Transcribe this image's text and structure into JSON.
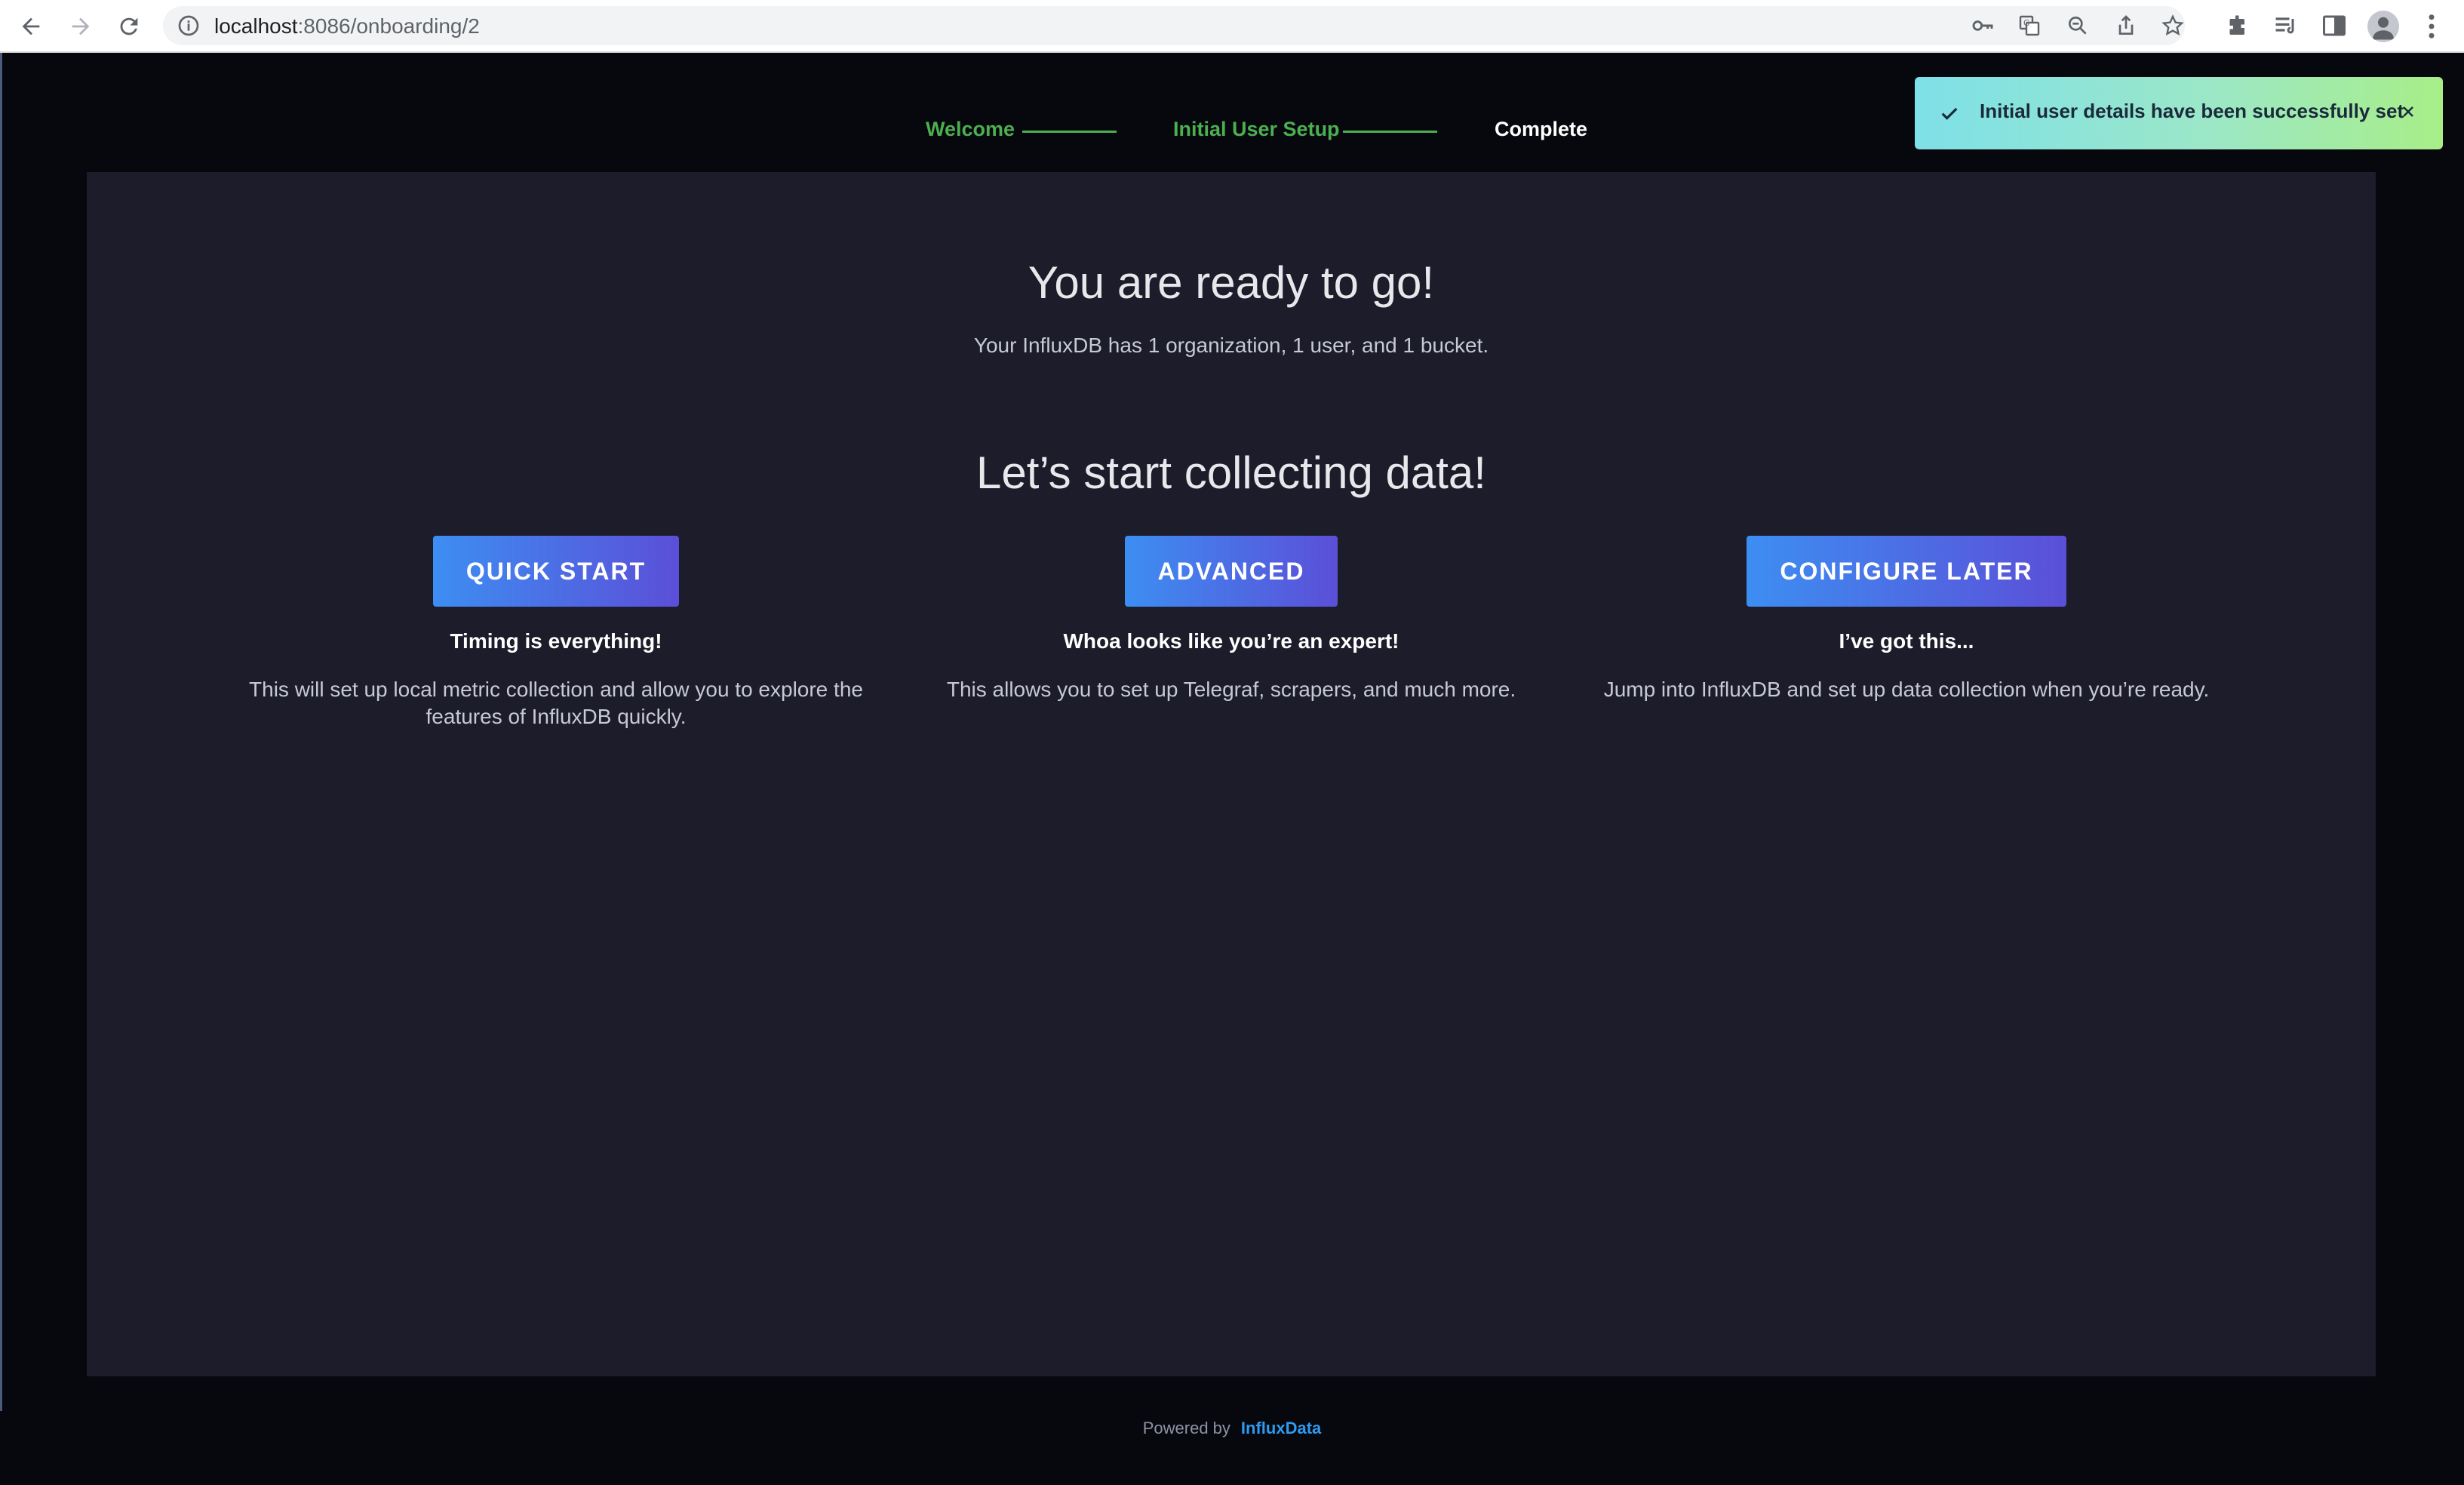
{
  "browser": {
    "url_host": "localhost",
    "url_path": ":8086/onboarding/2",
    "icons": [
      "back-icon",
      "forward-icon",
      "reload-icon",
      "info-icon",
      "key-icon",
      "translate-icon",
      "zoom-icon",
      "share-icon",
      "star-icon",
      "extensions-icon",
      "reading-list-icon",
      "side-panel-icon",
      "profile-icon",
      "menu-icon"
    ]
  },
  "stepper": {
    "steps": [
      {
        "label": "Welcome",
        "state": "done"
      },
      {
        "label": "Initial User Setup",
        "state": "done"
      },
      {
        "label": "Complete",
        "state": "current"
      }
    ]
  },
  "toast": {
    "message": "Initial user details have been successfully set"
  },
  "panel": {
    "ready_title": "You are ready to go!",
    "summary": "Your InfluxDB has 1 organization, 1 user, and 1 bucket.",
    "collect_title": "Let’s start collecting data!",
    "options": [
      {
        "button": "QUICK START",
        "heading": "Timing is everything!",
        "description": "This will set up local metric collection and allow you to explore the features of InfluxDB quickly."
      },
      {
        "button": "ADVANCED",
        "heading": "Whoa looks like you’re an expert!",
        "description": "This allows you to set up Telegraf, scrapers, and much more."
      },
      {
        "button": "CONFIGURE LATER",
        "heading": "I’ve got this...",
        "description": "Jump into InfluxDB and set up data collection when you’re ready."
      }
    ]
  },
  "footer": {
    "prefix": "Powered by",
    "link": "InfluxData"
  },
  "colors": {
    "background": "#07070e",
    "panel": "#1c1c2a",
    "step_done": "#4caf50",
    "button_start": "#3d8ef2",
    "button_end": "#5b4fd8",
    "footer_link": "#2e9bf0"
  }
}
